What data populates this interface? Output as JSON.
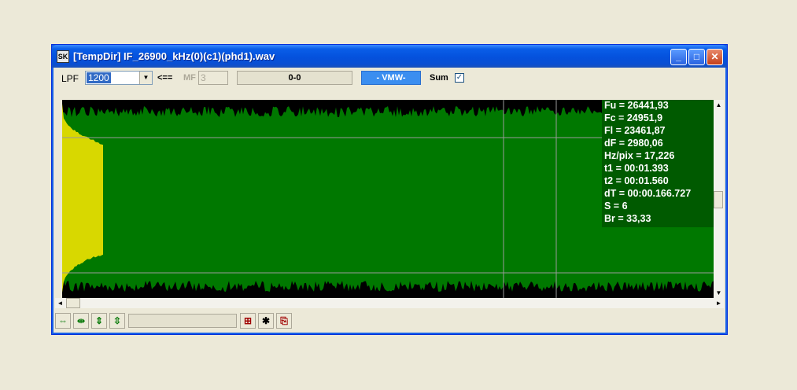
{
  "window": {
    "title": "[TempDir] IF_26900_kHz(0)(c1)(phd1).wav",
    "app_icon_text": "SK",
    "minimize": "_",
    "maximize": "□",
    "close": "✕"
  },
  "toolbar": {
    "lpf_label": "LPF",
    "lpf_value": "1200",
    "arrow_label": "<==",
    "mf_label": "MF",
    "mf_value": "3",
    "range_display": "0-0",
    "vmw_button": "- VMW-",
    "sum_label": "Sum",
    "sum_checked": "✓"
  },
  "info_panel": [
    "Fu = 26441,93",
    "Fc = 24951,9",
    "Fl = 23461,87",
    "dF = 2980,06",
    "Hz/pix = 17,226",
    "t1 = 00:01.393",
    "t2 = 00:01.560",
    "dT = 00:00.166.727",
    "S = 6",
    "Br = 33,33"
  ],
  "colors": {
    "spectrum_yellow": "#d8d800",
    "spectrum_green": "#007800",
    "background_black": "#000000",
    "info_panel_green": "#005a00",
    "title_blue": "#0451dd"
  },
  "bottom_bar": {
    "icons": [
      "expand-horizontal-icon",
      "shrink-horizontal-icon",
      "expand-vertical-icon",
      "shrink-vertical-icon",
      "chart-icon",
      "asterisk-icon",
      "copy-icon"
    ],
    "asterisk": "✱"
  }
}
